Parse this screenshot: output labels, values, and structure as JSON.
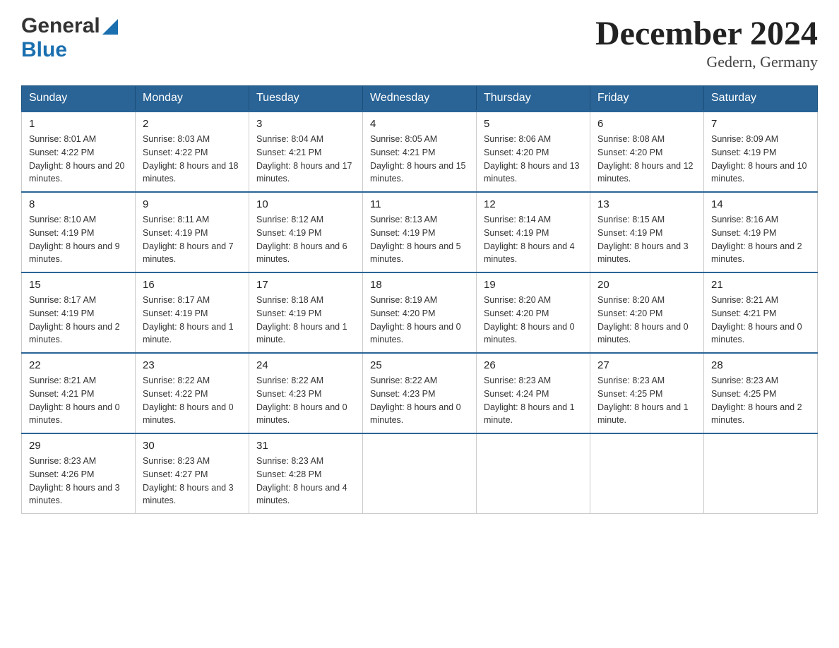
{
  "header": {
    "title": "December 2024",
    "subtitle": "Gedern, Germany",
    "logo_general": "General",
    "logo_blue": "Blue"
  },
  "calendar": {
    "days": [
      "Sunday",
      "Monday",
      "Tuesday",
      "Wednesday",
      "Thursday",
      "Friday",
      "Saturday"
    ],
    "weeks": [
      [
        {
          "date": "1",
          "sunrise": "8:01 AM",
          "sunset": "4:22 PM",
          "daylight": "8 hours and 20 minutes."
        },
        {
          "date": "2",
          "sunrise": "8:03 AM",
          "sunset": "4:22 PM",
          "daylight": "8 hours and 18 minutes."
        },
        {
          "date": "3",
          "sunrise": "8:04 AM",
          "sunset": "4:21 PM",
          "daylight": "8 hours and 17 minutes."
        },
        {
          "date": "4",
          "sunrise": "8:05 AM",
          "sunset": "4:21 PM",
          "daylight": "8 hours and 15 minutes."
        },
        {
          "date": "5",
          "sunrise": "8:06 AM",
          "sunset": "4:20 PM",
          "daylight": "8 hours and 13 minutes."
        },
        {
          "date": "6",
          "sunrise": "8:08 AM",
          "sunset": "4:20 PM",
          "daylight": "8 hours and 12 minutes."
        },
        {
          "date": "7",
          "sunrise": "8:09 AM",
          "sunset": "4:19 PM",
          "daylight": "8 hours and 10 minutes."
        }
      ],
      [
        {
          "date": "8",
          "sunrise": "8:10 AM",
          "sunset": "4:19 PM",
          "daylight": "8 hours and 9 minutes."
        },
        {
          "date": "9",
          "sunrise": "8:11 AM",
          "sunset": "4:19 PM",
          "daylight": "8 hours and 7 minutes."
        },
        {
          "date": "10",
          "sunrise": "8:12 AM",
          "sunset": "4:19 PM",
          "daylight": "8 hours and 6 minutes."
        },
        {
          "date": "11",
          "sunrise": "8:13 AM",
          "sunset": "4:19 PM",
          "daylight": "8 hours and 5 minutes."
        },
        {
          "date": "12",
          "sunrise": "8:14 AM",
          "sunset": "4:19 PM",
          "daylight": "8 hours and 4 minutes."
        },
        {
          "date": "13",
          "sunrise": "8:15 AM",
          "sunset": "4:19 PM",
          "daylight": "8 hours and 3 minutes."
        },
        {
          "date": "14",
          "sunrise": "8:16 AM",
          "sunset": "4:19 PM",
          "daylight": "8 hours and 2 minutes."
        }
      ],
      [
        {
          "date": "15",
          "sunrise": "8:17 AM",
          "sunset": "4:19 PM",
          "daylight": "8 hours and 2 minutes."
        },
        {
          "date": "16",
          "sunrise": "8:17 AM",
          "sunset": "4:19 PM",
          "daylight": "8 hours and 1 minute."
        },
        {
          "date": "17",
          "sunrise": "8:18 AM",
          "sunset": "4:19 PM",
          "daylight": "8 hours and 1 minute."
        },
        {
          "date": "18",
          "sunrise": "8:19 AM",
          "sunset": "4:20 PM",
          "daylight": "8 hours and 0 minutes."
        },
        {
          "date": "19",
          "sunrise": "8:20 AM",
          "sunset": "4:20 PM",
          "daylight": "8 hours and 0 minutes."
        },
        {
          "date": "20",
          "sunrise": "8:20 AM",
          "sunset": "4:20 PM",
          "daylight": "8 hours and 0 minutes."
        },
        {
          "date": "21",
          "sunrise": "8:21 AM",
          "sunset": "4:21 PM",
          "daylight": "8 hours and 0 minutes."
        }
      ],
      [
        {
          "date": "22",
          "sunrise": "8:21 AM",
          "sunset": "4:21 PM",
          "daylight": "8 hours and 0 minutes."
        },
        {
          "date": "23",
          "sunrise": "8:22 AM",
          "sunset": "4:22 PM",
          "daylight": "8 hours and 0 minutes."
        },
        {
          "date": "24",
          "sunrise": "8:22 AM",
          "sunset": "4:23 PM",
          "daylight": "8 hours and 0 minutes."
        },
        {
          "date": "25",
          "sunrise": "8:22 AM",
          "sunset": "4:23 PM",
          "daylight": "8 hours and 0 minutes."
        },
        {
          "date": "26",
          "sunrise": "8:23 AM",
          "sunset": "4:24 PM",
          "daylight": "8 hours and 1 minute."
        },
        {
          "date": "27",
          "sunrise": "8:23 AM",
          "sunset": "4:25 PM",
          "daylight": "8 hours and 1 minute."
        },
        {
          "date": "28",
          "sunrise": "8:23 AM",
          "sunset": "4:25 PM",
          "daylight": "8 hours and 2 minutes."
        }
      ],
      [
        {
          "date": "29",
          "sunrise": "8:23 AM",
          "sunset": "4:26 PM",
          "daylight": "8 hours and 3 minutes."
        },
        {
          "date": "30",
          "sunrise": "8:23 AM",
          "sunset": "4:27 PM",
          "daylight": "8 hours and 3 minutes."
        },
        {
          "date": "31",
          "sunrise": "8:23 AM",
          "sunset": "4:28 PM",
          "daylight": "8 hours and 4 minutes."
        },
        null,
        null,
        null,
        null
      ]
    ],
    "labels": {
      "sunrise": "Sunrise:",
      "sunset": "Sunset:",
      "daylight": "Daylight:"
    }
  }
}
